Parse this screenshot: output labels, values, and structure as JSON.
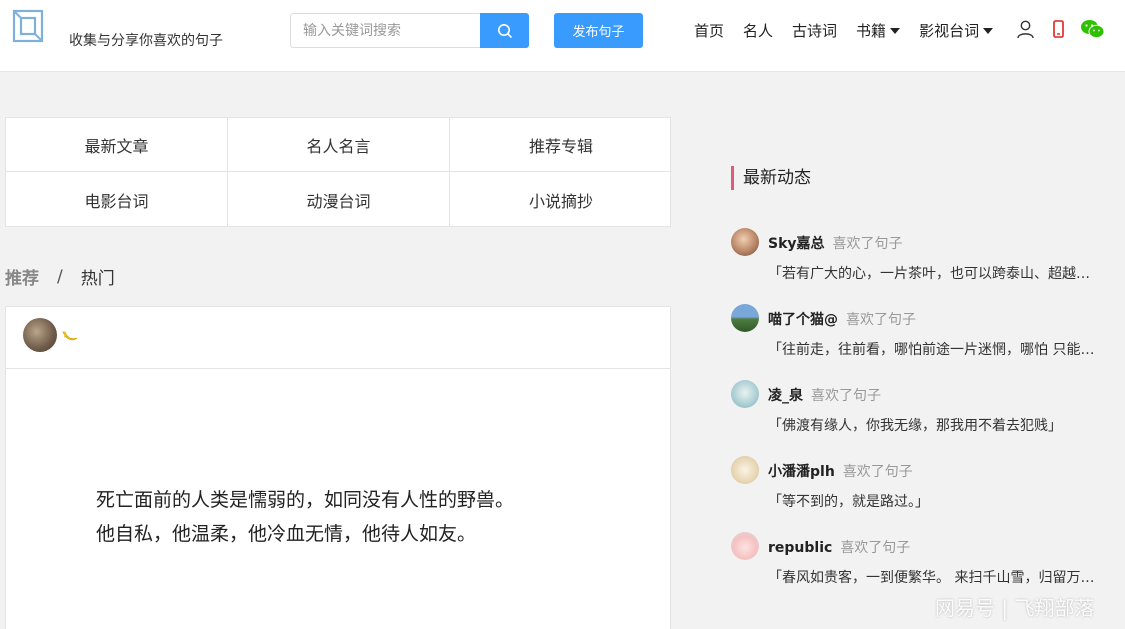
{
  "header": {
    "tagline": "收集与分享你喜欢的句子",
    "search_placeholder": "输入关键词搜索",
    "publish_label": "发布句子",
    "accent_color": "#3a9bff",
    "nav": [
      {
        "label": "首页"
      },
      {
        "label": "名人"
      },
      {
        "label": "古诗词"
      },
      {
        "label": "书籍",
        "dropdown": true
      },
      {
        "label": "影视台词",
        "dropdown": true
      }
    ],
    "icons": [
      "user-icon",
      "mobile-icon",
      "wechat-icon"
    ]
  },
  "categories": [
    "最新文章",
    "名人名言",
    "推荐专辑",
    "电影台词",
    "动漫台词",
    "小说摘抄"
  ],
  "tabs": {
    "recommended": "推荐",
    "separator": "/",
    "hot": "热门"
  },
  "post": {
    "lines": [
      "死亡面前的人类是懦弱的，如同没有人性的野兽。",
      "他自私，他温柔，他冷血无情，他待人如友。"
    ]
  },
  "sidebar": {
    "title": "最新动态",
    "accent_color": "#e05a7a",
    "items": [
      {
        "user": "Sky嘉总",
        "action": "喜欢了句子",
        "text": "「若有广大的心，一片茶叶，也可以跨泰山、超越江海」"
      },
      {
        "user": "喵了个猫@",
        "action": "喜欢了句子",
        "text": "「往前走，往前看，哪怕前途一片迷惘，哪怕 只能一个人」"
      },
      {
        "user": "凌_泉",
        "action": "喜欢了句子",
        "text": "「佛渡有缘人，你我无缘，那我用不着去犯贱」"
      },
      {
        "user": "小潘潘plh",
        "action": "喜欢了句子",
        "text": "「等不到的，就是路过。」"
      },
      {
        "user": "republic",
        "action": "喜欢了句子",
        "text": "「春风如贵客，一到便繁华。 来扫千山雪，归留万国花」"
      }
    ]
  },
  "watermark": "网易号 | 飞翔部落"
}
